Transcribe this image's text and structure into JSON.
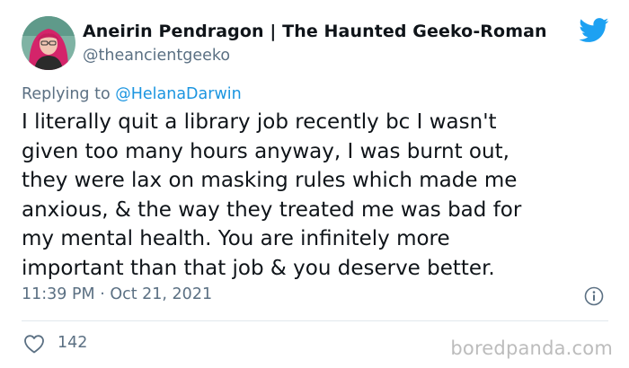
{
  "author": {
    "display_name": "Aneirin Pendragon | The Haunted Geeko-Roman",
    "handle": "@theancientgeeko"
  },
  "reply": {
    "prefix": "Replying to ",
    "to_handle": "@HelanaDarwin"
  },
  "tweet": {
    "lines": [
      "I literally quit a library job recently bc I wasn't",
      "given too many hours anyway, I was burnt out,",
      "they were lax on masking rules which made me",
      "anxious, & the way they treated me was bad for",
      "my mental health. You are infinitely more",
      "important than that job & you deserve better."
    ]
  },
  "meta": {
    "timestamp": "11:39 PM · Oct 21, 2021"
  },
  "engagement": {
    "likes": "142"
  },
  "watermark": "boredpanda.com",
  "icons": {
    "brand": "twitter-bird-icon",
    "info": "info-icon",
    "like": "heart-icon"
  },
  "colors": {
    "link": "#1b95e0",
    "twitter_blue": "#1da1f2",
    "secondary_text": "#5b7083",
    "primary_text": "#0f1419"
  }
}
